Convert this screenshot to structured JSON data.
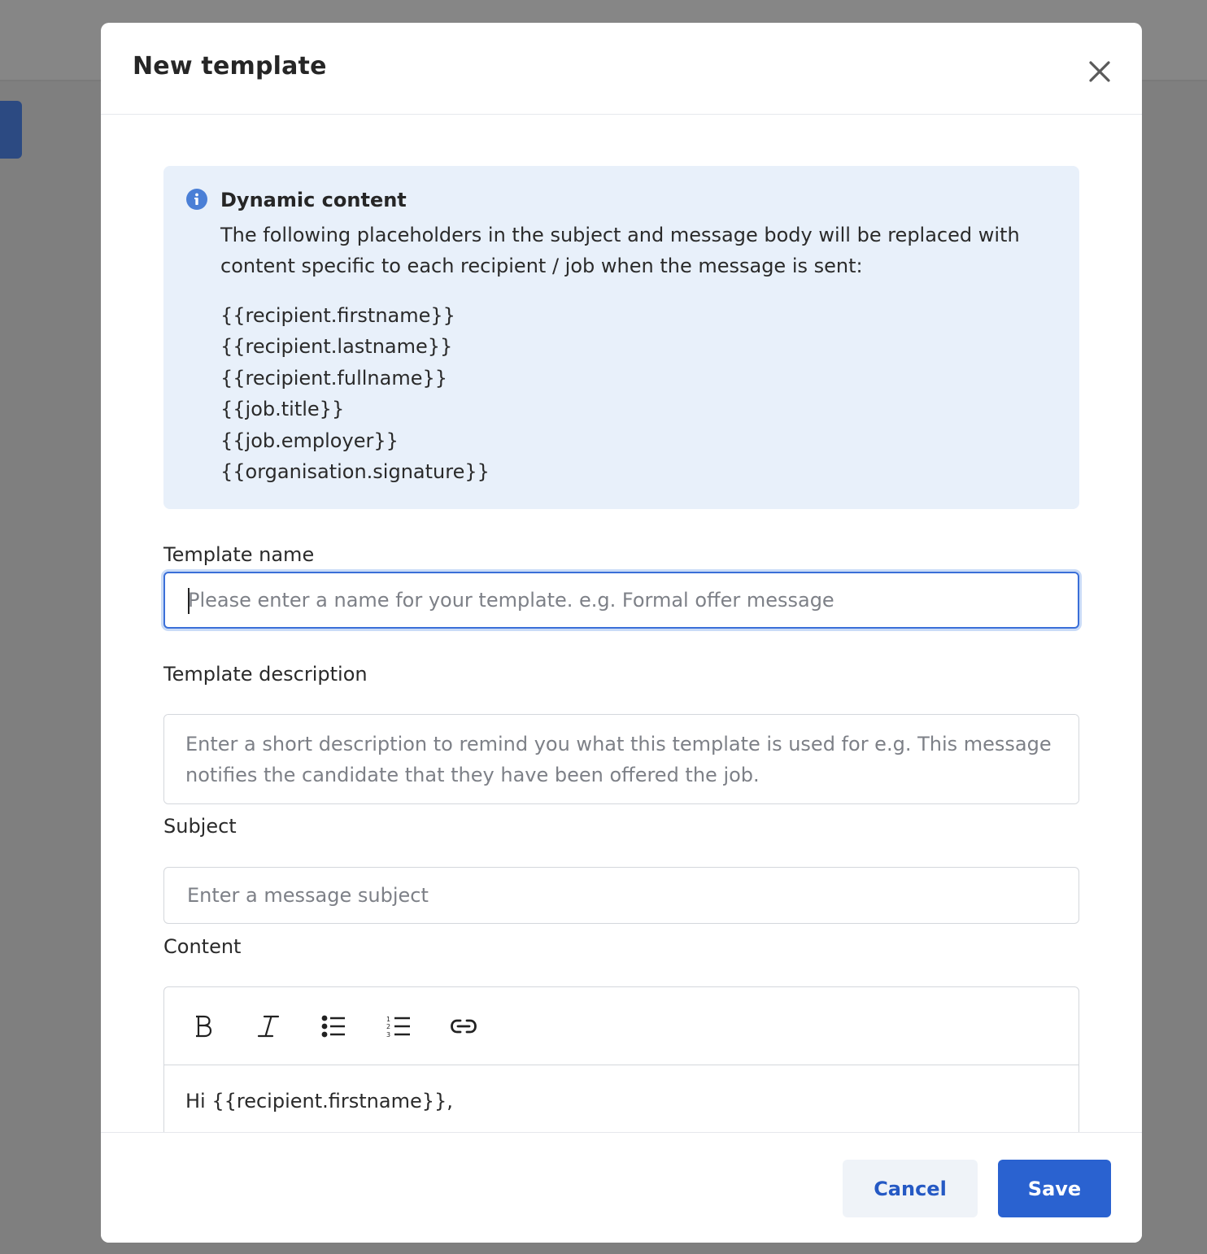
{
  "modal": {
    "title": "New template"
  },
  "info": {
    "title": "Dynamic content",
    "text": "The following placeholders in the subject and message body will be replaced with content specific to each recipient / job when the message is sent:",
    "placeholders": [
      "{{recipient.firstname}}",
      "{{recipient.lastname}}",
      "{{recipient.fullname}}",
      "{{job.title}}",
      "{{job.employer}}",
      "{{organisation.signature}}"
    ]
  },
  "fields": {
    "name": {
      "label": "Template name",
      "value": "",
      "placeholder": "Please enter a name for your template. e.g. Formal offer message"
    },
    "description": {
      "label": "Template description",
      "value": "",
      "placeholder": "Enter a short description to remind you what this template is used for e.g. This message notifies the candidate that they have been offered the job."
    },
    "subject": {
      "label": "Subject",
      "value": "",
      "placeholder": "Enter a message subject"
    },
    "content": {
      "label": "Content",
      "toolbar": [
        "bold-icon",
        "italic-icon",
        "bullet-list-icon",
        "numbered-list-icon",
        "link-icon"
      ],
      "body": "Hi {{recipient.firstname}},"
    }
  },
  "footer": {
    "cancel_label": "Cancel",
    "save_label": "Save"
  },
  "colors": {
    "accent": "#2a62d0",
    "info_background": "#e8f0fa",
    "info_icon": "#4a7fd6",
    "overlay": "#7f7f7f"
  }
}
